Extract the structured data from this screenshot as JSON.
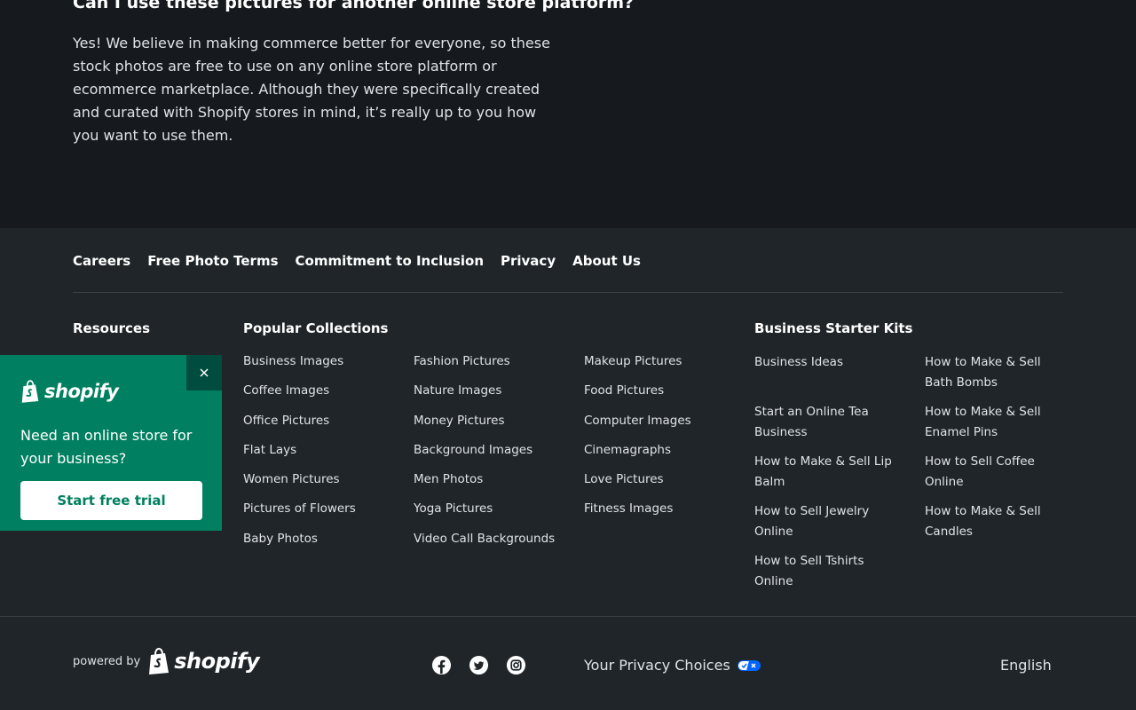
{
  "faq": {
    "question": "Can I use these pictures for another online store platform?",
    "answer": "Yes! We believe in making commerce better for everyone, so these stock photos are free to use on any online store platform or ecommerce marketplace. Although they were specifically created and curated with Shopify stores in mind, it’s really up to you how you want to use them."
  },
  "top_links": [
    "Careers",
    "Free Photo Terms",
    "Commitment to Inclusion",
    "Privacy",
    "About Us"
  ],
  "headings": {
    "resources": "Resources",
    "popular": "Popular Collections",
    "starter": "Business Starter Kits"
  },
  "popular_col1": [
    "Business Images",
    "Coffee Images",
    "Office Pictures",
    "Flat Lays",
    "Women Pictures",
    "Pictures of Flowers",
    "Baby Photos"
  ],
  "popular_col2": [
    "Fashion Pictures",
    "Nature Images",
    "Money Pictures",
    "Background Images",
    "Men Photos",
    "Yoga Pictures",
    "Video Call Backgrounds"
  ],
  "popular_col3": [
    "Makeup Pictures",
    "Food Pictures",
    "Computer Images",
    "Cinemagraphs",
    "Love Pictures",
    "Fitness Images"
  ],
  "kits_col1": [
    "Business Ideas",
    "Start an Online Tea Business",
    "How to Make & Sell Lip Balm",
    "How to Sell Jewelry Online",
    "How to Sell Tshirts Online"
  ],
  "kits_col2": [
    "How to Make & Sell Bath Bombs",
    "How to Make & Sell Enamel Pins",
    "How to Sell Coffee Online",
    "How to Make & Sell Candles"
  ],
  "footer_bottom": {
    "powered_by": "powered by",
    "brand": "shopify",
    "privacy_choices": "Your Privacy Choices",
    "language": "English",
    "social_icons": [
      "facebook-icon",
      "twitter-icon",
      "instagram-icon"
    ]
  },
  "promo": {
    "brand": "shopify",
    "text": "Need an online store for your business?",
    "button": "Start free trial"
  },
  "colors": {
    "page_bg": "#161a1e",
    "footer_bg": "#1f2529",
    "promo_bg": "#008060",
    "promo_close_bg": "#004c3f"
  }
}
